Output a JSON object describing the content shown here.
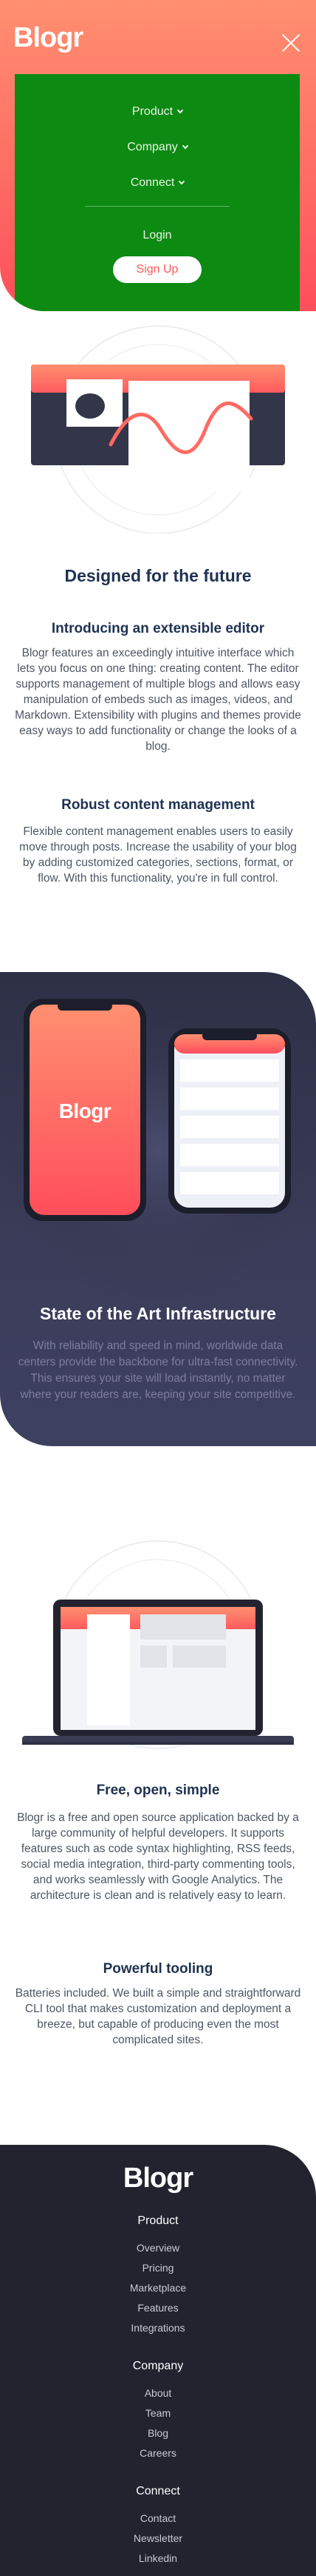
{
  "header": {
    "logo": "Blogr",
    "menu": [
      {
        "label": "Product"
      },
      {
        "label": "Company"
      },
      {
        "label": "Connect"
      }
    ],
    "login_label": "Login",
    "signup_label": "Sign Up"
  },
  "section_future": {
    "title": "Designed for the future",
    "features": [
      {
        "title": "Introducing an extensible editor",
        "text": "Blogr features an exceedingly intuitive interface which lets you focus on one thing: creating content. The editor supports management of multiple blogs and allows easy manipulation of embeds such as images, videos, and Markdown. Extensibility with plugins and themes provide easy ways to add functionality or change the looks of a blog."
      },
      {
        "title": "Robust content management",
        "text": "Flexible content management enables users to easily move through posts. Increase the usability of your blog by adding customized categories, sections, format, or flow. With this functionality, you're in full control."
      }
    ]
  },
  "infrastructure": {
    "phone_logo": "Blogr",
    "title": "State of the Art Infrastructure",
    "text": "With reliability and speed in mind, worldwide data centers provide the backbone for ultra-fast connectivity. This ensures your site will load instantly, no matter where your readers are, keeping your site competitive."
  },
  "section_free": {
    "features": [
      {
        "title": "Free, open, simple",
        "text": "Blogr is a free and open source application backed by a large community of helpful developers. It supports features such as code syntax highlighting, RSS feeds, social media integration, third-party commenting tools, and works seamlessly with Google Analytics. The architecture is clean and is relatively easy to learn."
      },
      {
        "title": "Powerful tooling",
        "text": "Batteries included. We built a simple and straightforward CLI tool that makes customization and deployment a breeze, but capable of producing even the most complicated sites."
      }
    ]
  },
  "footer": {
    "logo": "Blogr",
    "columns": [
      {
        "heading": "Product",
        "links": [
          "Overview",
          "Pricing",
          "Marketplace",
          "Features",
          "Integrations"
        ]
      },
      {
        "heading": "Company",
        "links": [
          "About",
          "Team",
          "Blog",
          "Careers"
        ]
      },
      {
        "heading": "Connect",
        "links": [
          "Contact",
          "Newsletter",
          "Linkedin"
        ]
      }
    ]
  },
  "colors": {
    "brand_red": "#ff5b5e",
    "menu_green": "#0c8a12",
    "heading_navy": "#1f3251",
    "dark_bg": "#2e3046",
    "footer_bg": "#232330"
  }
}
